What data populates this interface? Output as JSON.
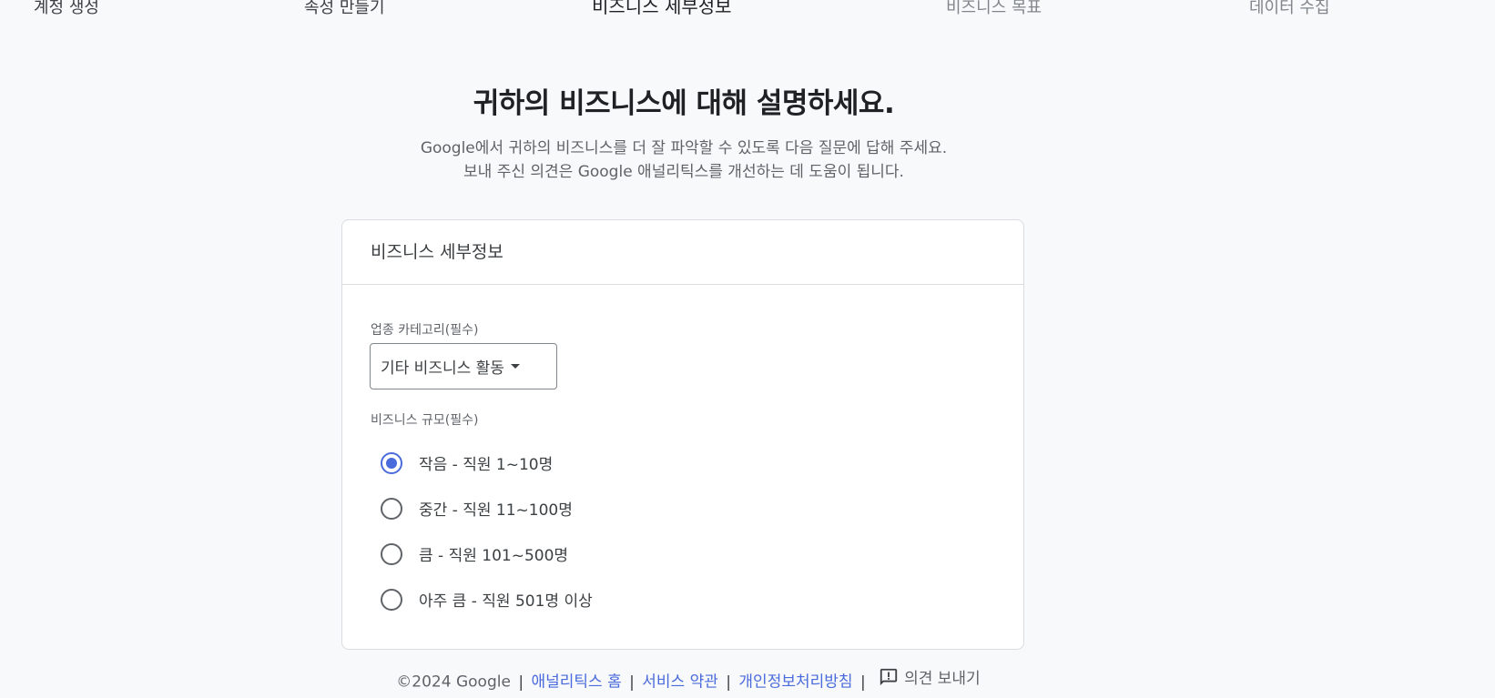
{
  "stepper": {
    "steps": [
      {
        "label": "계정 생성"
      },
      {
        "label": "속성 만들기"
      },
      {
        "label": "비즈니스 세부정보"
      },
      {
        "label": "비즈니스 목표"
      },
      {
        "label": "데이터 수집"
      }
    ]
  },
  "page": {
    "title": "귀하의 비즈니스에 대해 설명하세요.",
    "subtitle_line1": "Google에서 귀하의 비즈니스를 더 잘 파악할 수 있도록 다음 질문에 답해 주세요.",
    "subtitle_line2": "보내 주신 의견은 Google 애널리틱스를 개선하는 데 도움이 됩니다."
  },
  "card": {
    "title": "비즈니스 세부정보",
    "industry_label": "업종 카테고리(필수)",
    "industry_value": "기타 비즈니스 활동",
    "size_label": "비즈니스 규모(필수)",
    "size_options": [
      {
        "label": "작음 - 직원 1~10명",
        "selected": true
      },
      {
        "label": "중간 - 직원 11~100명",
        "selected": false
      },
      {
        "label": "큼 - 직원 101~500명",
        "selected": false
      },
      {
        "label": "아주 큼 - 직원 501명 이상",
        "selected": false
      }
    ]
  },
  "footer": {
    "copyright": "©2024 Google",
    "sep": "|",
    "home_link": "애널리틱스 홈",
    "terms_link": "서비스 약관",
    "privacy_link": "개인정보처리방침",
    "feedback": "의견 보내기"
  },
  "colors": {
    "accent": "#4a6bdc",
    "background": "#f8f9fa"
  }
}
